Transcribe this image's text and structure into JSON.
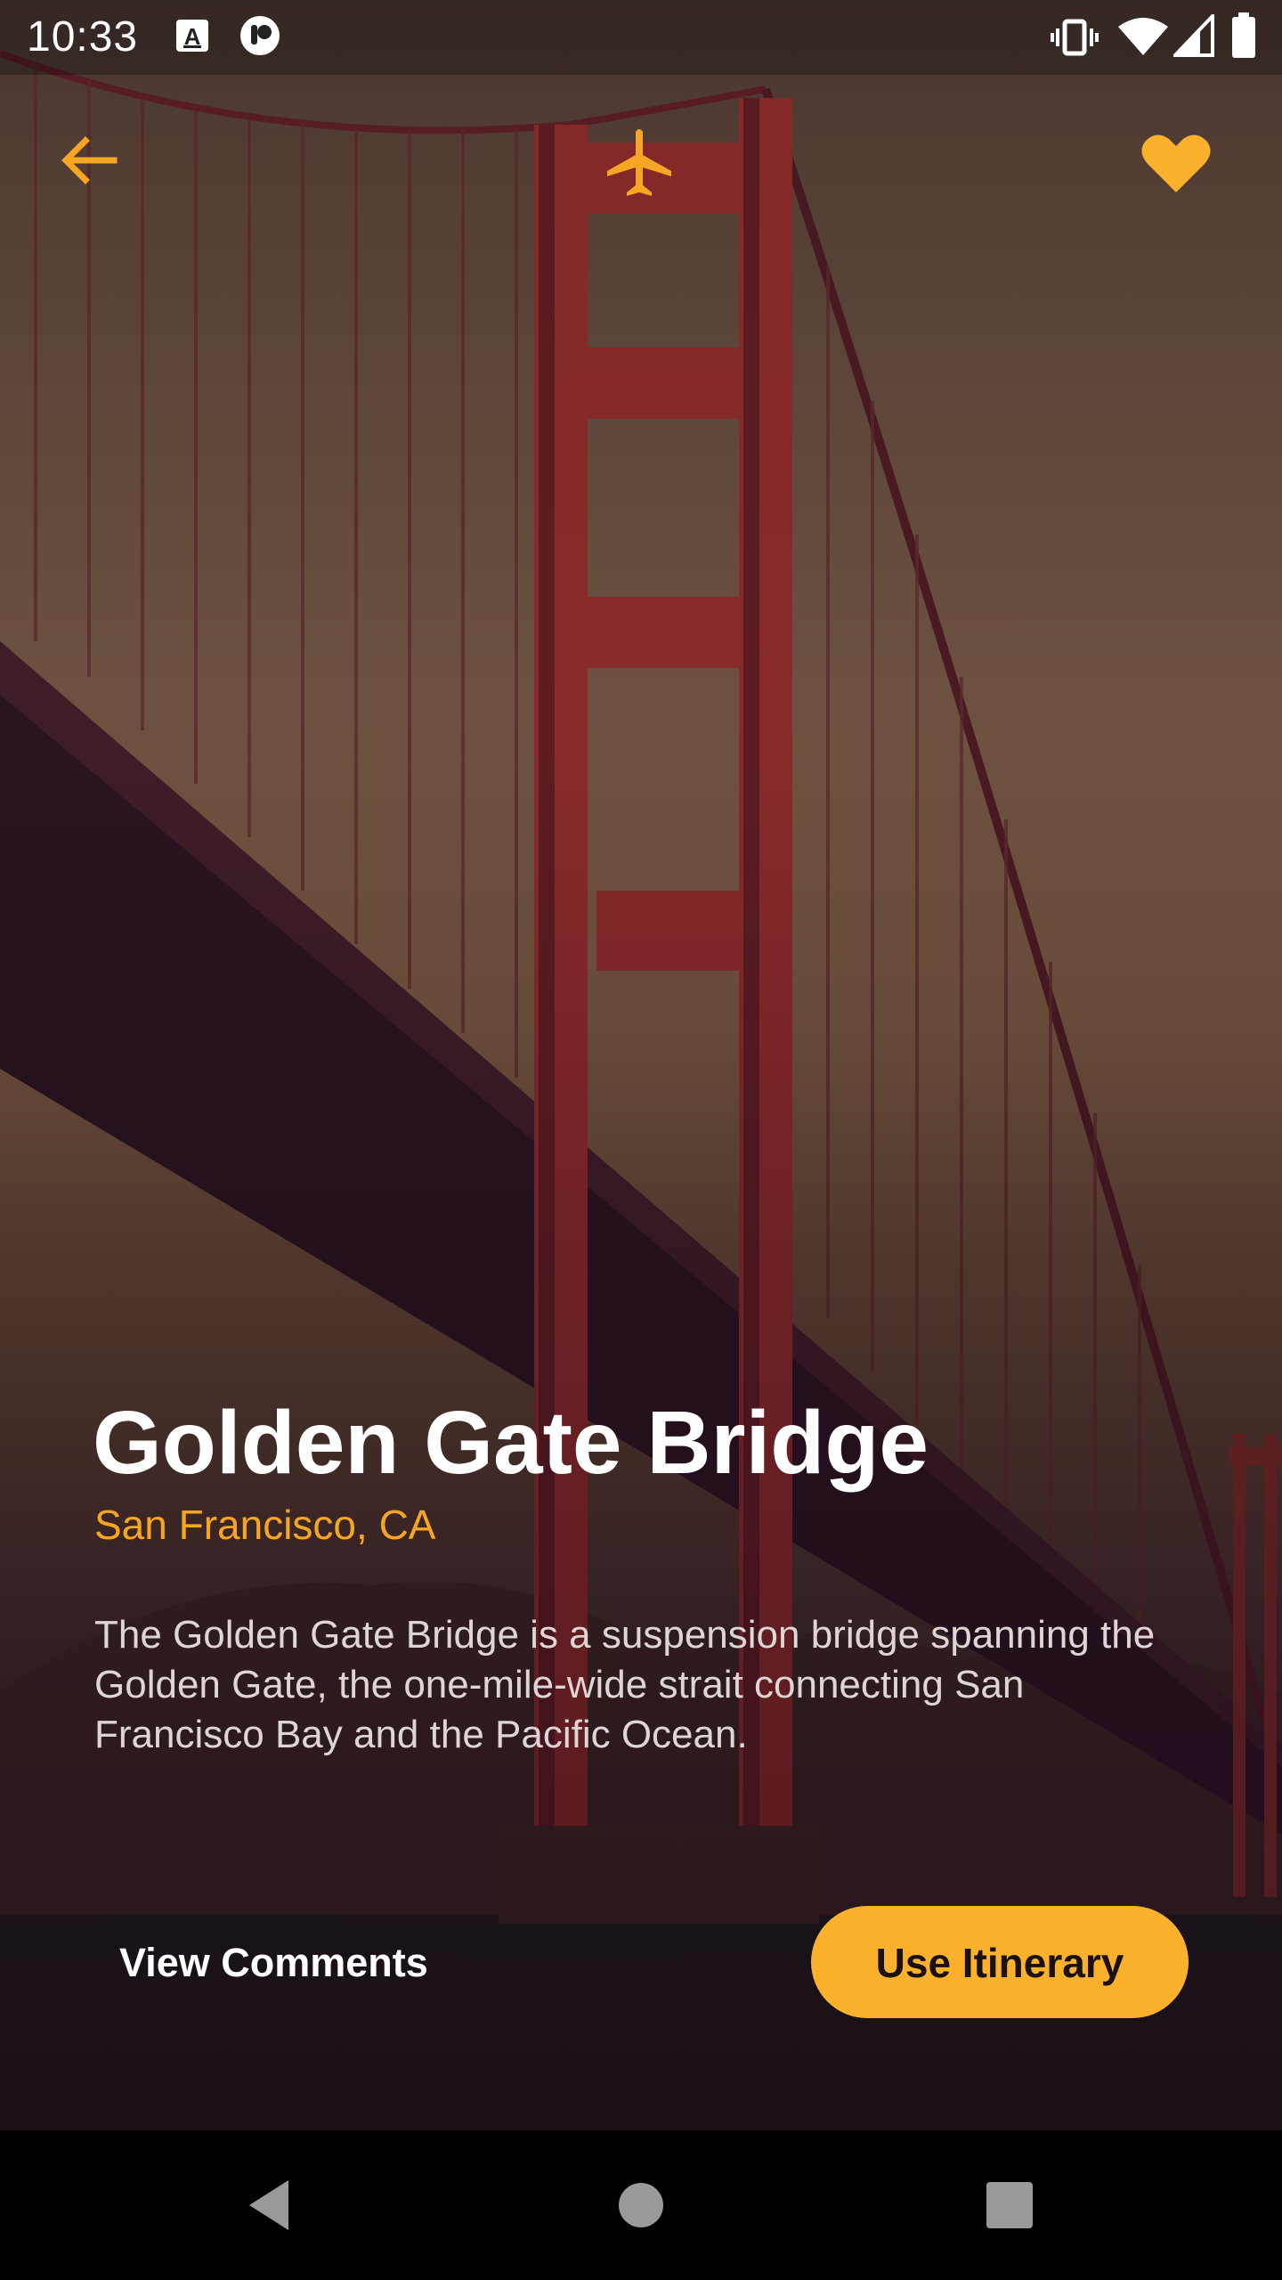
{
  "status_bar": {
    "time": "10:33",
    "left_icons": [
      "text-a-notification-icon",
      "circle-app-notification-icon"
    ],
    "right_icons": [
      "vibrate-icon",
      "wifi-icon",
      "cell-signal-icon",
      "battery-icon"
    ]
  },
  "app_bar": {
    "back_icon": "arrow-back-icon",
    "center_icon": "airplane-icon",
    "favorite_icon": "heart-icon"
  },
  "place": {
    "title": "Golden Gate Bridge",
    "location": "San Francisco, CA",
    "description": "The Golden Gate Bridge is a suspension bridge spanning the Golden Gate, the one-mile-wide strait connecting San Francisco Bay and the Pacific Ocean."
  },
  "actions": {
    "view_comments_label": "View Comments",
    "use_itinerary_label": "Use Itinerary"
  },
  "nav_bar": {
    "icons": [
      "nav-back-icon",
      "nav-home-icon",
      "nav-recents-icon"
    ]
  },
  "colors": {
    "accent": "#fbb12b",
    "subtitle": "#f6a623",
    "title": "#ffffff",
    "body_text": "#ddd6d4"
  }
}
